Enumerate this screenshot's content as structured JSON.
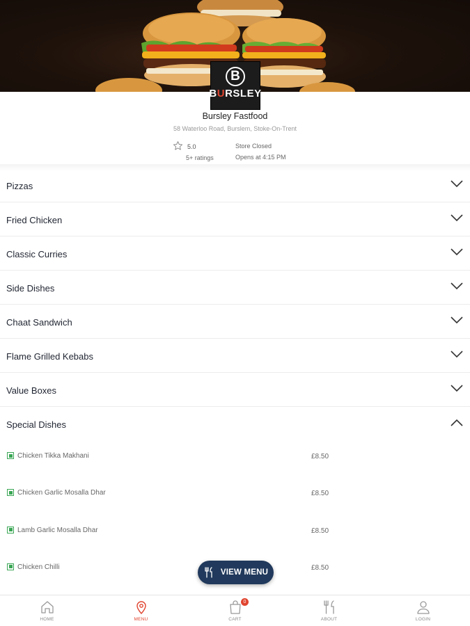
{
  "store": {
    "logo_initial": "B",
    "logo_word_start": "B",
    "logo_word_highlight": "U",
    "logo_word_end": "RSLEY",
    "name": "Bursley Fastfood",
    "address": "58 Waterloo Road, Burslem, Stoke-On-Trent",
    "rating": "5.0",
    "rating_count": "5+ ratings",
    "status": "Store Closed",
    "opens": "Opens at 4:15 PM"
  },
  "categories": [
    {
      "label": "Pizzas",
      "expanded": false
    },
    {
      "label": "Fried Chicken",
      "expanded": false
    },
    {
      "label": "Classic Curries",
      "expanded": false
    },
    {
      "label": "Side Dishes",
      "expanded": false
    },
    {
      "label": "Chaat Sandwich",
      "expanded": false
    },
    {
      "label": "Flame Grilled Kebabs",
      "expanded": false
    },
    {
      "label": "Value Boxes",
      "expanded": false
    },
    {
      "label": "Special Dishes",
      "expanded": true
    }
  ],
  "special_dishes": [
    {
      "name": "Chicken Tikka Makhani",
      "price": "£8.50"
    },
    {
      "name": "Chicken Garlic Mosalla Dhar",
      "price": "£8.50"
    },
    {
      "name": "Lamb Garlic Mosalla Dhar",
      "price": "£8.50"
    },
    {
      "name": "Chicken Chilli",
      "price": "£8.50"
    }
  ],
  "view_menu_label": "VIEW MENU",
  "bottom_nav": [
    {
      "label": "HOME",
      "icon": "home-icon",
      "active": false
    },
    {
      "label": "MENU",
      "icon": "location-pin-icon",
      "active": true
    },
    {
      "label": "CART",
      "icon": "shopping-bag-icon",
      "active": false,
      "badge": "0"
    },
    {
      "label": "ABOUT",
      "icon": "utensils-icon",
      "active": false
    },
    {
      "label": "LOGIN",
      "icon": "user-icon",
      "active": false
    }
  ],
  "colors": {
    "accent": "#e0442f",
    "button_bg": "#20395c",
    "veg": "#3aa655"
  }
}
